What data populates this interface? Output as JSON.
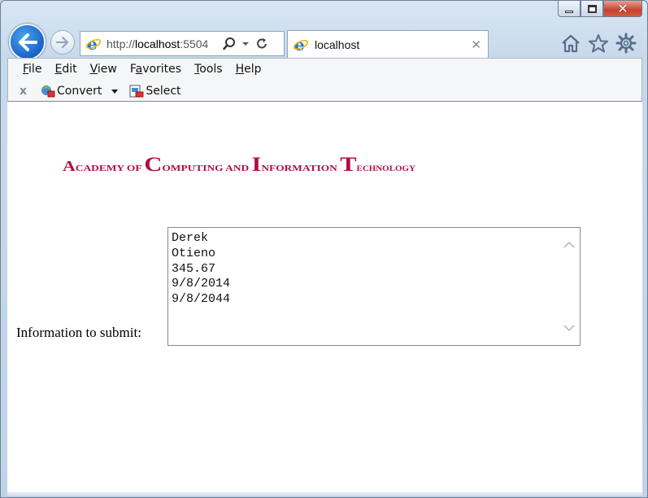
{
  "browser": {
    "address_prefix": "http://",
    "address_host": "localhost",
    "address_port": ":5504",
    "tab_title": "localhost",
    "caption": {
      "minimize": "minimize",
      "maximize": "maximize",
      "close": "close"
    }
  },
  "menu": {
    "items": [
      {
        "label": "File",
        "underline": "F"
      },
      {
        "label": "Edit",
        "underline": "E"
      },
      {
        "label": "View",
        "underline": "V"
      },
      {
        "label": "Favorites",
        "underline": "a"
      },
      {
        "label": "Tools",
        "underline": "T"
      },
      {
        "label": "Help",
        "underline": "H"
      }
    ]
  },
  "commandbar": {
    "close": "x",
    "convert": "Convert",
    "select": "Select"
  },
  "page": {
    "logo_text": "Academy of Computing and Information Technology",
    "form_label": "Information to submit:",
    "textarea_value": "Derek\nOtieno\n345.67\n9/8/2014\n9/8/2044"
  },
  "colors": {
    "logo": "#b01040",
    "back_button": "#1a63c4",
    "close_button": "#c8412c"
  }
}
